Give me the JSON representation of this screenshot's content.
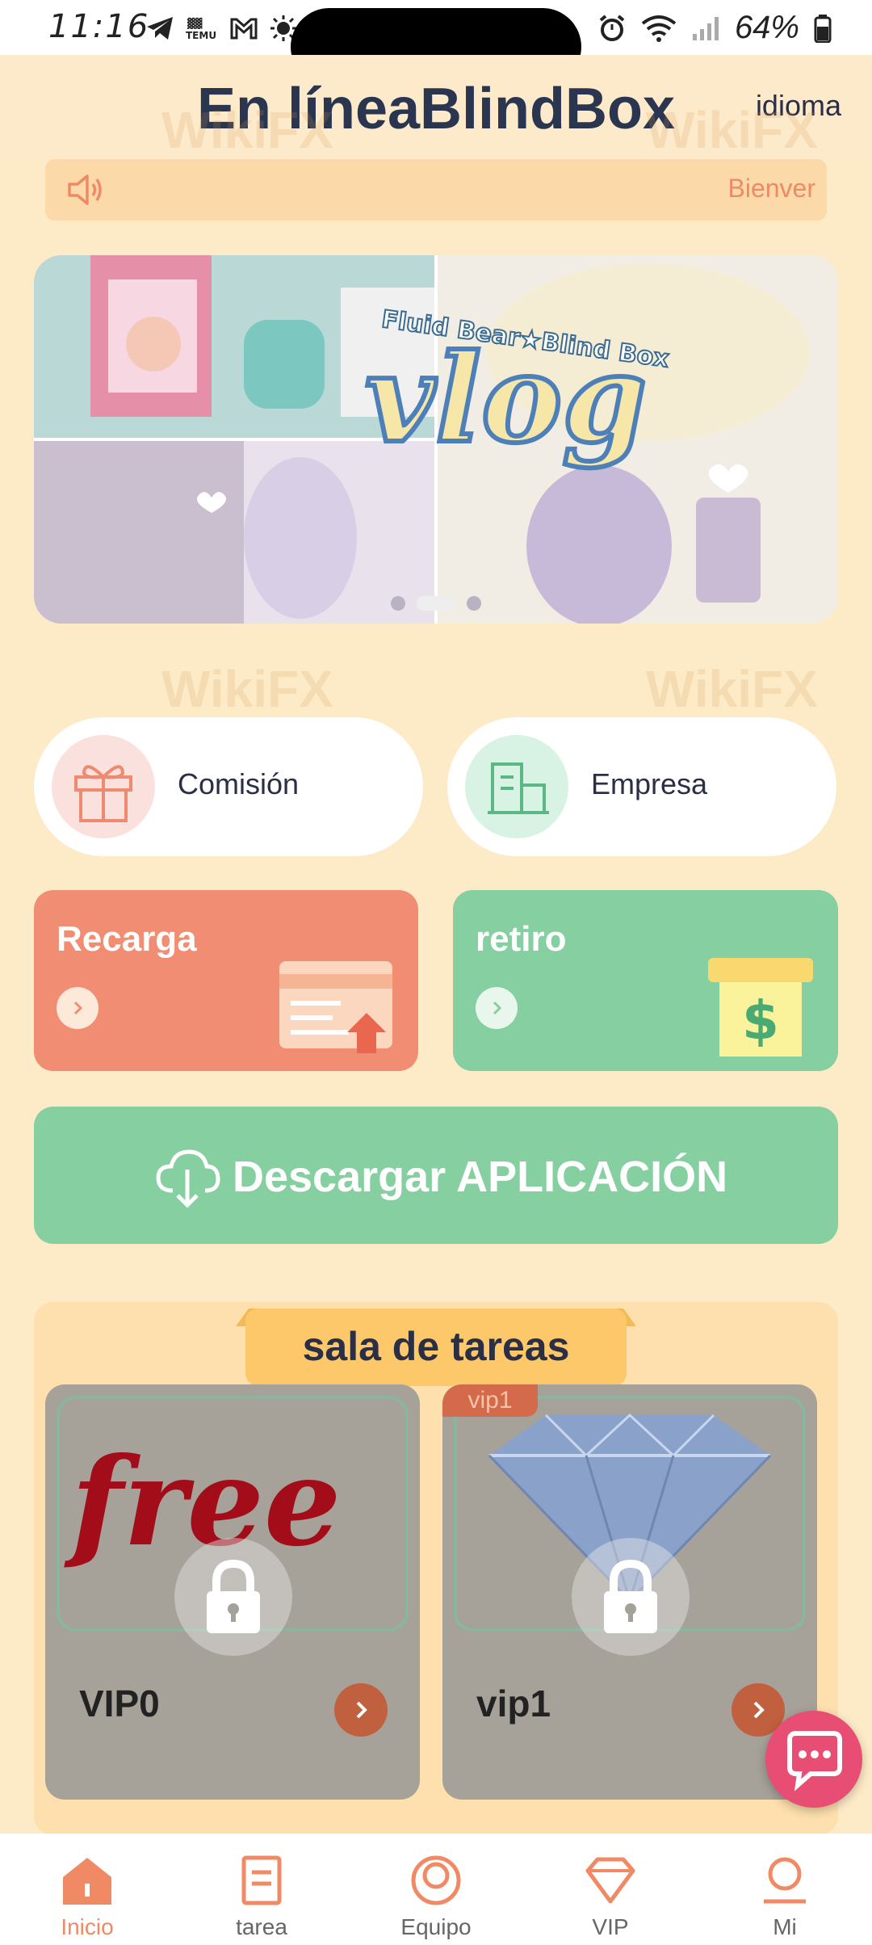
{
  "status_bar": {
    "time": "11:16",
    "battery": "64%",
    "icons": [
      "telegram-icon",
      "temu-icon",
      "gmail-icon",
      "weather-icon",
      "alarm-icon",
      "wifi-icon",
      "signal-icon",
      "battery-icon"
    ]
  },
  "header": {
    "title": "En líneaBlindBox",
    "language_label": "idioma"
  },
  "notice": {
    "text": "Bienver",
    "icon": "speaker-icon"
  },
  "banner": {
    "headline": "vlog",
    "subheadline": "Fluid Bear★Blind Box",
    "slide_count": 3,
    "active_slide": 2
  },
  "quick_links": [
    {
      "label": "Comisión",
      "icon": "gift-icon",
      "color": "#fbe1de"
    },
    {
      "label": "Empresa",
      "icon": "building-icon",
      "color": "#d8f2e4"
    }
  ],
  "actions": {
    "recharge": {
      "label": "Recarga",
      "color": "#f08d73"
    },
    "withdraw": {
      "label": "retiro",
      "color": "#85cfa0"
    }
  },
  "download": {
    "label": "Descargar APLICACIÓN"
  },
  "task_hall": {
    "title": "sala de tareas",
    "tasks": [
      {
        "name": "VIP0",
        "image_text": "free",
        "badge": ""
      },
      {
        "name": "vip1",
        "image_text": "",
        "badge": "vip1"
      }
    ]
  },
  "watermark": "WikiFX",
  "bottom_nav": [
    {
      "label": "Inicio",
      "icon": "home-icon",
      "active": true
    },
    {
      "label": "tarea",
      "icon": "task-icon",
      "active": false
    },
    {
      "label": "Equipo",
      "icon": "team-icon",
      "active": false
    },
    {
      "label": "VIP",
      "icon": "diamond-icon",
      "active": false
    },
    {
      "label": "Mi",
      "icon": "profile-icon",
      "active": false
    }
  ],
  "colors": {
    "accent": "#ef8a65",
    "green": "#85cfa0",
    "background": "#fdebc8"
  }
}
